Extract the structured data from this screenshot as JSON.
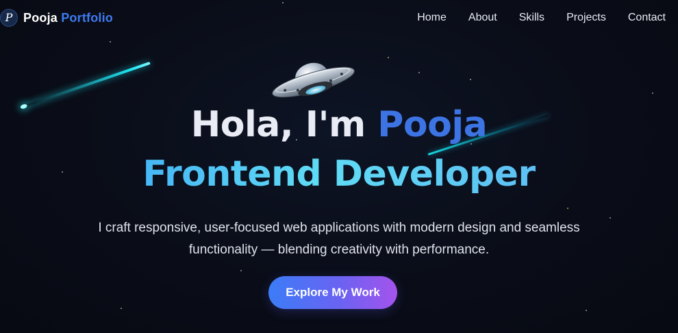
{
  "nav": {
    "brand_logo": "P",
    "brand_name": "Pooja",
    "brand_accent": "Portfolio",
    "links": [
      {
        "label": "Home"
      },
      {
        "label": "About"
      },
      {
        "label": "Skills"
      },
      {
        "label": "Projects"
      },
      {
        "label": "Contact"
      }
    ]
  },
  "hero": {
    "greeting": "Hola, I'm ",
    "name": "Pooja",
    "role": "Frontend Developer",
    "description": "I craft responsive, user-focused web applications with modern design and seamless functionality — blending creativity with performance.",
    "cta_label": "Explore My Work",
    "ufo_icon": "ufo-icon"
  },
  "colors": {
    "background": "#0a0e1a",
    "brand_accent": "#3d7bf0",
    "name_accent": "#3d74e4",
    "role_gradient_start": "#47b6f5",
    "role_gradient_end": "#5fdcf5",
    "cta_gradient_start": "#3b7cf7",
    "cta_gradient_end": "#a453ec",
    "meteor": "#1ee4f0"
  }
}
